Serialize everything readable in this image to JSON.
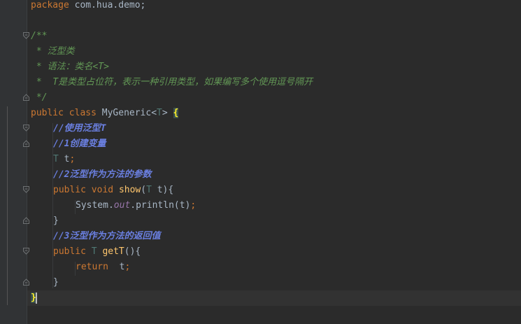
{
  "editor": {
    "language": "Java",
    "colors": {
      "background": "#2b2b2b",
      "keyword": "#cc7832",
      "doc_comment": "#629755",
      "line_comment": "#6a7fe0",
      "type_param": "#507874",
      "method": "#ffc66d",
      "static_field": "#9876aa",
      "default_text": "#a9b7c6"
    },
    "lines": {
      "l1": {
        "kw": "package",
        "rest": " com.hua.demo;"
      },
      "l3": {
        "text": "/**"
      },
      "l4": {
        "text": " * 泛型类"
      },
      "l5": {
        "text": " * 语法：类名<T>"
      },
      "l6": {
        "text": " *  T是类型占位符，表示一种引用类型，如果编写多个使用逗号隔开"
      },
      "l7": {
        "text": " */"
      },
      "l8": {
        "kw1": "public",
        "kw2": "class",
        "name": " MyGeneric<",
        "tp": "T",
        "close": "> ",
        "brace": "{"
      },
      "l9": {
        "text": "//使用泛型T"
      },
      "l10": {
        "text": "//1创建变量"
      },
      "l11": {
        "tp": "T",
        "rest": " t",
        "semi": ";"
      },
      "l12": {
        "text": "//2泛型作为方法的参数"
      },
      "l13": {
        "kw1": "public",
        "kw2": "void",
        "fn": "show",
        "open": "(",
        "tp": "T",
        "rest": " t){"
      },
      "l14": {
        "pre": "System.",
        "field": "out",
        "post": ".println(t)",
        "semi": ";"
      },
      "l15": {
        "text": "}"
      },
      "l16": {
        "text": "//3泛型作为方法的返回值"
      },
      "l17": {
        "kw1": "public",
        "tp": "T",
        "fn": "getT",
        "rest": "(){"
      },
      "l18": {
        "kw": "return",
        "rest": "  t",
        "semi": ";"
      },
      "l19": {
        "text": "}"
      },
      "l20": {
        "text": "}"
      }
    },
    "fold_icons": [
      "fold-open-icon",
      "fold-close-icon"
    ],
    "current_line": 20
  }
}
